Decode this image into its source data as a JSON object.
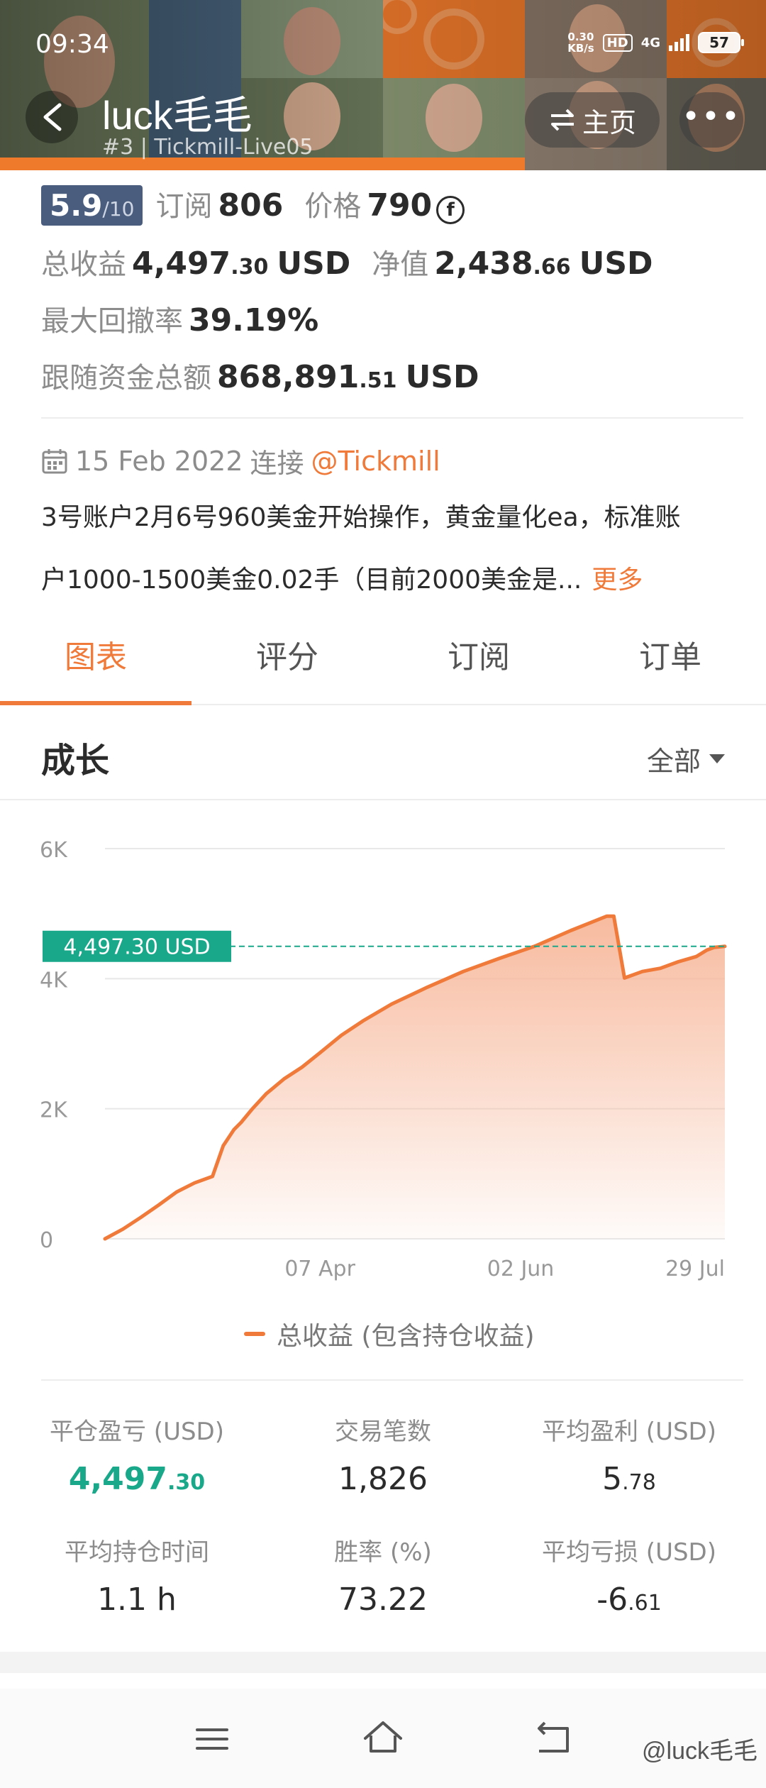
{
  "status_bar": {
    "time": "09:34",
    "net_speed_value": "0.30",
    "net_speed_unit": "KB/s",
    "hd": "HD",
    "network": "4G",
    "battery": "57"
  },
  "header": {
    "trader_name": "luck毛毛",
    "account_sub": "#3 | Tickmill-Live05",
    "home_label": "主页",
    "more_label": "•••"
  },
  "stats": {
    "rating": "5.9",
    "rating_max": "/10",
    "subscribe_label": "订阅",
    "subscribe_value": "806",
    "price_label": "价格",
    "price_value": "790",
    "coin_symbol": "f",
    "total_profit_label": "总收益",
    "total_profit_int": "4,497",
    "total_profit_dec": ".30",
    "total_profit_unit": "USD",
    "equity_label": "净值",
    "equity_int": "2,438",
    "equity_dec": ".66",
    "equity_unit": "USD",
    "max_drawdown_label": "最大回撤率",
    "max_drawdown_value": "39.19%",
    "follow_funds_label": "跟随资金总额",
    "follow_funds_int": "868,891",
    "follow_funds_dec": ".51",
    "follow_funds_unit": "USD"
  },
  "connection": {
    "date": "15 Feb 2022",
    "connect_label": "连接",
    "broker": "@Tickmill"
  },
  "description": {
    "line1": "3号账户2月6号960美金开始操作，黄金量化ea，标准账",
    "line2": "户1000-1500美金0.02手（目前2000美金是...",
    "more_label": "更多"
  },
  "tabs": [
    {
      "label": "图表",
      "active": true
    },
    {
      "label": "评分",
      "active": false
    },
    {
      "label": "订阅",
      "active": false
    },
    {
      "label": "订单",
      "active": false
    }
  ],
  "chart_section": {
    "title": "成长",
    "range_label": "全部",
    "legend_label": "总收益 (包含持仓收益)"
  },
  "chart_data": {
    "type": "area",
    "x_tick_labels": [
      "07 Apr",
      "02 Jun",
      "29 Jul"
    ],
    "x_tick_days": [
      60,
      116,
      173
    ],
    "y_tick_labels": [
      "6K",
      "4K",
      "2K",
      "0"
    ],
    "y_tick_values": [
      6000,
      4000,
      2000,
      0
    ],
    "ylim": [
      0,
      6000
    ],
    "xlim": [
      0,
      173
    ],
    "x_unit": "days",
    "current_value_label": "4,497.30 USD",
    "current_value": 4497.3,
    "series": [
      {
        "name": "总收益 (包含持仓收益)",
        "x": [
          0,
          5,
          10,
          15,
          20,
          25,
          30,
          33,
          36,
          38,
          41,
          45,
          50,
          55,
          60,
          66,
          72,
          80,
          90,
          100,
          110,
          120,
          125,
          130,
          135,
          140,
          142,
          145,
          150,
          155,
          160,
          165,
          168,
          170,
          173
        ],
        "y": [
          0,
          150,
          330,
          520,
          720,
          860,
          960,
          1430,
          1680,
          1790,
          1990,
          2230,
          2460,
          2640,
          2860,
          3130,
          3350,
          3610,
          3870,
          4110,
          4310,
          4500,
          4620,
          4740,
          4850,
          4960,
          4960,
          4010,
          4110,
          4160,
          4260,
          4340,
          4440,
          4480,
          4497
        ]
      }
    ],
    "line_color": "#f07a3a",
    "fill_color": "#f7b79a",
    "marker_color": "#1aa88a",
    "grid": true
  },
  "metrics": [
    {
      "label": "平仓盈亏 (USD)",
      "int": "4,497",
      "dec": ".30",
      "positive": true
    },
    {
      "label": "交易笔数",
      "int": "1,826",
      "dec": "",
      "positive": false
    },
    {
      "label": "平均盈利 (USD)",
      "int": "5",
      "dec": ".78",
      "positive": false
    },
    {
      "label": "平均持仓时间",
      "int": "1.1 h",
      "dec": "",
      "positive": false
    },
    {
      "label": "胜率 (%)",
      "int": "73.22",
      "dec": "",
      "positive": false
    },
    {
      "label": "平均亏损 (USD)",
      "int": "-6",
      "dec": ".61",
      "positive": false
    }
  ],
  "nav": {
    "watermark": "@luck毛毛"
  },
  "colors": {
    "accent": "#f07a3a",
    "positive": "#1aa88a",
    "badge": "#4a5d7e"
  }
}
